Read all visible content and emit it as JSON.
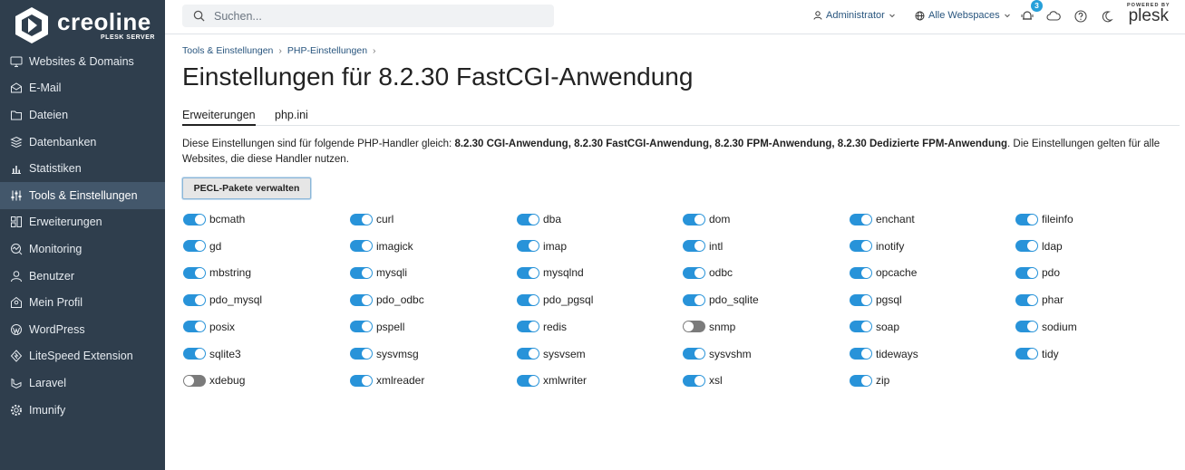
{
  "brand": {
    "name": "creoline",
    "subtitle": "PLESK SERVER"
  },
  "sidebar": {
    "items": [
      {
        "label": "Websites & Domains",
        "icon": "monitor-icon",
        "active": false
      },
      {
        "label": "E-Mail",
        "icon": "mail-icon",
        "active": false
      },
      {
        "label": "Dateien",
        "icon": "folder-icon",
        "active": false
      },
      {
        "label": "Datenbanken",
        "icon": "database-icon",
        "active": false
      },
      {
        "label": "Statistiken",
        "icon": "bar-chart-icon",
        "active": false
      },
      {
        "label": "Tools & Einstellungen",
        "icon": "sliders-icon",
        "active": true
      },
      {
        "label": "Erweiterungen",
        "icon": "extensions-icon",
        "active": false
      },
      {
        "label": "Monitoring",
        "icon": "monitoring-icon",
        "active": false
      },
      {
        "label": "Benutzer",
        "icon": "user-icon",
        "active": false
      },
      {
        "label": "Mein Profil",
        "icon": "profile-icon",
        "active": false
      },
      {
        "label": "WordPress",
        "icon": "wordpress-icon",
        "active": false
      },
      {
        "label": "LiteSpeed Extension",
        "icon": "litespeed-icon",
        "active": false
      },
      {
        "label": "Laravel",
        "icon": "laravel-icon",
        "active": false
      },
      {
        "label": "Imunify",
        "icon": "gear-icon",
        "active": false
      }
    ]
  },
  "topbar": {
    "search_placeholder": "Suchen...",
    "user_label": "Administrator",
    "webspaces_label": "Alle Webspaces",
    "notification_count": "3",
    "plesk_small": "POWERED BY",
    "plesk_big": "plesk"
  },
  "breadcrumb": [
    "Tools & Einstellungen",
    "PHP-Einstellungen"
  ],
  "page_title": "Einstellungen für 8.2.30 FastCGI-Anwendung",
  "tabs": [
    {
      "label": "Erweiterungen",
      "active": true
    },
    {
      "label": "php.ini",
      "active": false
    }
  ],
  "description": {
    "prefix": "Diese Einstellungen sind für folgende PHP-Handler gleich: ",
    "handlers": "8.2.30 CGI-Anwendung, 8.2.30 FastCGI-Anwendung, 8.2.30 FPM-Anwendung, 8.2.30 Dedizierte FPM-Anwendung",
    "suffix": ". Die Einstellungen gelten für alle Websites, die diese Handler nutzen."
  },
  "pecl_button": "PECL-Pakete verwalten",
  "extensions": [
    {
      "name": "bcmath",
      "on": true
    },
    {
      "name": "curl",
      "on": true
    },
    {
      "name": "dba",
      "on": true
    },
    {
      "name": "dom",
      "on": true
    },
    {
      "name": "enchant",
      "on": true
    },
    {
      "name": "fileinfo",
      "on": true
    },
    {
      "name": "gd",
      "on": true
    },
    {
      "name": "imagick",
      "on": true
    },
    {
      "name": "imap",
      "on": true
    },
    {
      "name": "intl",
      "on": true
    },
    {
      "name": "inotify",
      "on": true
    },
    {
      "name": "ldap",
      "on": true
    },
    {
      "name": "mbstring",
      "on": true
    },
    {
      "name": "mysqli",
      "on": true
    },
    {
      "name": "mysqlnd",
      "on": true
    },
    {
      "name": "odbc",
      "on": true
    },
    {
      "name": "opcache",
      "on": true
    },
    {
      "name": "pdo",
      "on": true
    },
    {
      "name": "pdo_mysql",
      "on": true
    },
    {
      "name": "pdo_odbc",
      "on": true
    },
    {
      "name": "pdo_pgsql",
      "on": true
    },
    {
      "name": "pdo_sqlite",
      "on": true
    },
    {
      "name": "pgsql",
      "on": true
    },
    {
      "name": "phar",
      "on": true
    },
    {
      "name": "posix",
      "on": true
    },
    {
      "name": "pspell",
      "on": true
    },
    {
      "name": "redis",
      "on": true
    },
    {
      "name": "snmp",
      "on": false
    },
    {
      "name": "soap",
      "on": true
    },
    {
      "name": "sodium",
      "on": true
    },
    {
      "name": "sqlite3",
      "on": true
    },
    {
      "name": "sysvmsg",
      "on": true
    },
    {
      "name": "sysvsem",
      "on": true
    },
    {
      "name": "sysvshm",
      "on": true
    },
    {
      "name": "tideways",
      "on": true
    },
    {
      "name": "tidy",
      "on": true
    },
    {
      "name": "xdebug",
      "on": false
    },
    {
      "name": "xmlreader",
      "on": true
    },
    {
      "name": "xmlwriter",
      "on": true
    },
    {
      "name": "xsl",
      "on": true
    },
    {
      "name": "zip",
      "on": true
    }
  ],
  "colors": {
    "sidebar_bg": "#2f3e4d",
    "sidebar_active": "#43576b",
    "toggle_on": "#2893d9",
    "toggle_off": "#7b7b7b",
    "link": "#28557e"
  }
}
